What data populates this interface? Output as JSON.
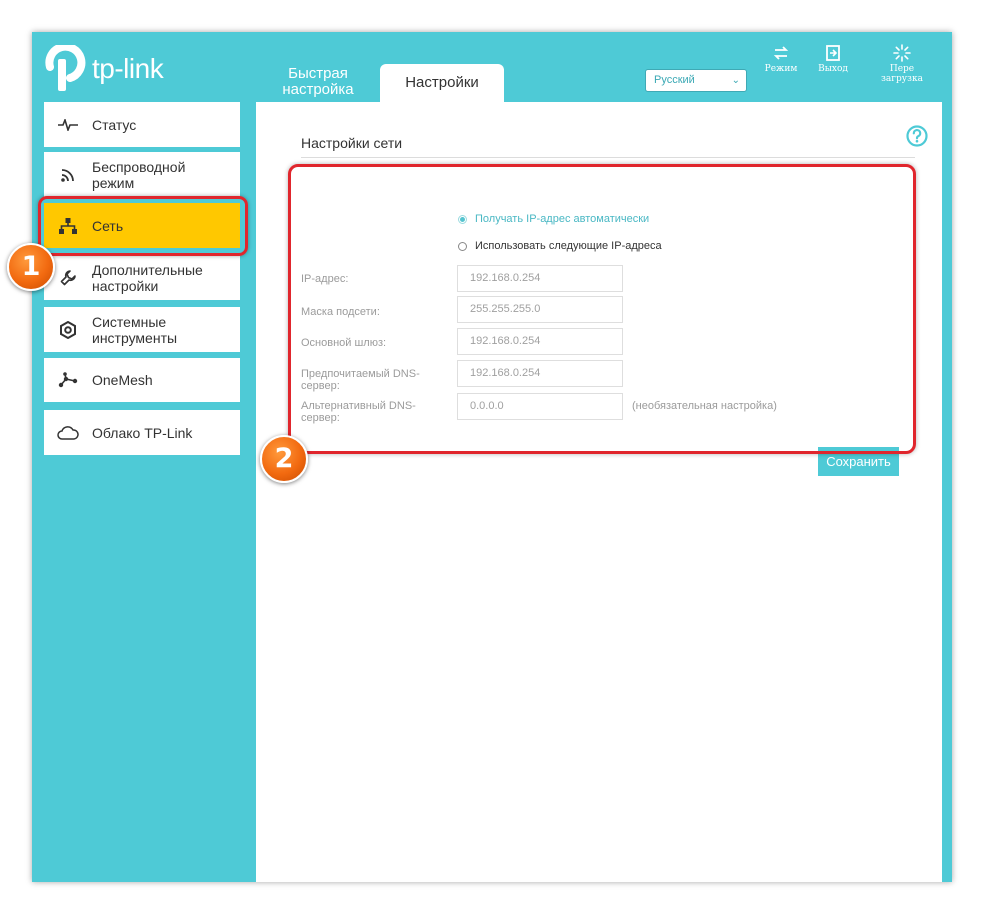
{
  "brand": {
    "logo_text": "tp-link"
  },
  "colors": {
    "accent": "#4ecad6",
    "highlight": "#ffc800",
    "annotation_red": "#e0262d",
    "badge_orange": "#f26a10"
  },
  "header": {
    "tabs": [
      {
        "label": "Быстрая настройка",
        "active": false
      },
      {
        "label": "Настройки",
        "active": true
      }
    ],
    "language": {
      "selected": "Русский"
    },
    "buttons": [
      {
        "label": "Режим",
        "icon": "mode-icon"
      },
      {
        "label": "Выход",
        "icon": "logout-icon"
      },
      {
        "label": "Пере загрузка",
        "icon": "reboot-icon"
      }
    ]
  },
  "sidebar": {
    "items": [
      {
        "label": "Статус",
        "icon": "status-pulse-icon",
        "active": false
      },
      {
        "label": "Беспроводной режим",
        "icon": "wireless-icon",
        "active": false
      },
      {
        "label": "Сеть",
        "icon": "network-icon",
        "active": true
      },
      {
        "label": "Дополнительные настройки",
        "icon": "wrench-icon",
        "active": false
      },
      {
        "label": "Системные инструменты",
        "icon": "gear-icon",
        "active": false
      },
      {
        "label": "OneMesh",
        "icon": "mesh-icon",
        "active": false
      },
      {
        "label": "Облако TP-Link",
        "icon": "cloud-icon",
        "active": false
      }
    ]
  },
  "main": {
    "title": "Настройки сети",
    "ip_mode": {
      "auto_label": "Получать IP-адрес автоматически",
      "manual_label": "Использовать следующие IP-адреса",
      "selected": "auto"
    },
    "fields": [
      {
        "label": "IP-адрес:",
        "value": "192.168.0.254"
      },
      {
        "label": "Маска подсети:",
        "value": "255.255.255.0"
      },
      {
        "label": "Основной шлюз:",
        "value": "192.168.0.254"
      },
      {
        "label": "Предпочитаемый DNS-сервер:",
        "value": "192.168.0.254"
      },
      {
        "label": "Альтернативный DNS-сервер:",
        "value": "0.0.0.0",
        "note": "(необязательная настройка)"
      }
    ],
    "save_label": "Сохранить"
  },
  "annotations": {
    "badge_1": "1",
    "badge_2": "2"
  }
}
